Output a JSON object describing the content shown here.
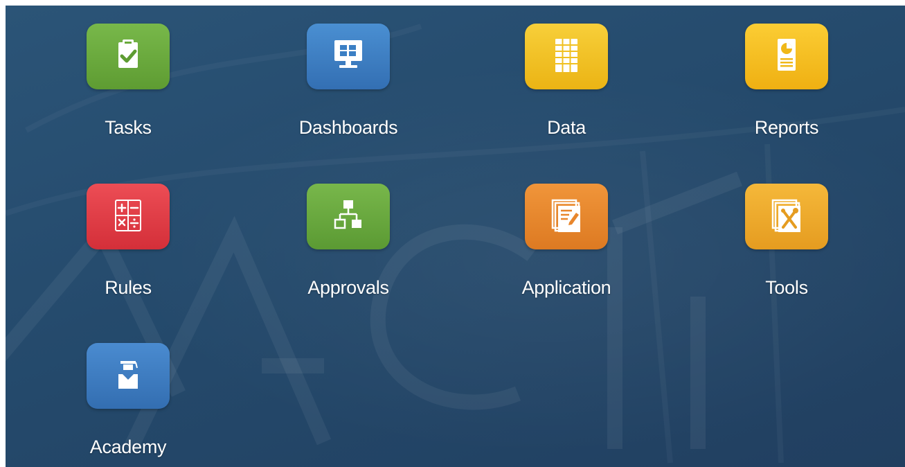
{
  "tiles": [
    {
      "label": "Tasks",
      "icon": "clipboard-check-icon",
      "color": "#6aaa3c"
    },
    {
      "label": "Dashboards",
      "icon": "monitor-icon",
      "color": "#3b7fc4"
    },
    {
      "label": "Data",
      "icon": "grid-icon",
      "color": "#f0c020"
    },
    {
      "label": "Reports",
      "icon": "report-icon",
      "color": "#f5be1c"
    },
    {
      "label": "Rules",
      "icon": "calculator-icon",
      "color": "#e03a42"
    },
    {
      "label": "Approvals",
      "icon": "hierarchy-icon",
      "color": "#6aa83c"
    },
    {
      "label": "Application",
      "icon": "application-icon",
      "color": "#e8862c"
    },
    {
      "label": "Tools",
      "icon": "tools-icon",
      "color": "#eeaa2a"
    },
    {
      "label": "Academy",
      "icon": "graduate-icon",
      "color": "#3a7cc2"
    }
  ]
}
